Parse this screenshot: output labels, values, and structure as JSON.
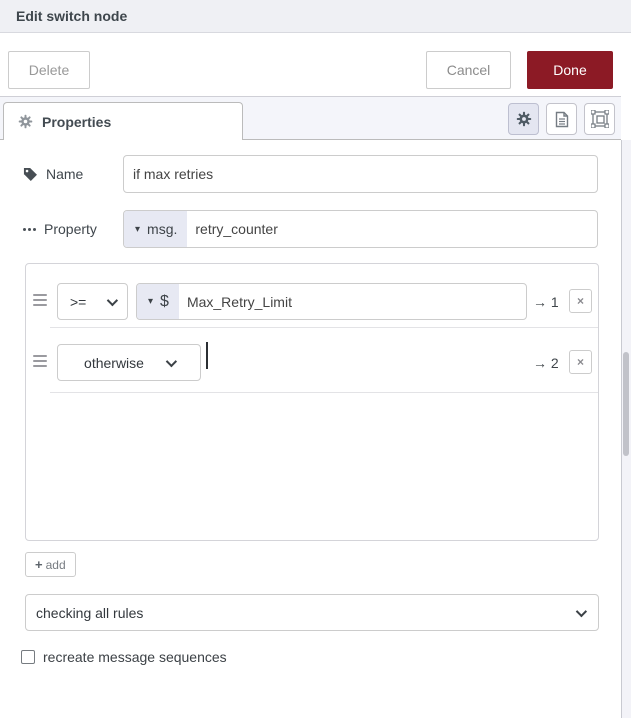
{
  "header": {
    "title": "Edit switch node"
  },
  "toolbar": {
    "delete_label": "Delete",
    "cancel_label": "Cancel",
    "done_label": "Done"
  },
  "tabbar": {
    "properties_label": "Properties",
    "icon_buttons": [
      "gear-icon",
      "description-icon",
      "group-icon"
    ]
  },
  "fields": {
    "name_label": "Name",
    "name_value": "if max retries",
    "property_label": "Property",
    "property_prefix_caret": "▾",
    "property_prefix": "msg.",
    "property_value": "retry_counter"
  },
  "rules": [
    {
      "operator": ">=",
      "value_prefix_caret": "▾",
      "value_type": "$",
      "value": "Max_Retry_Limit",
      "arrow": "→",
      "output": "1",
      "remove": "×"
    },
    {
      "operator": "otherwise",
      "arrow": "→",
      "output": "2",
      "remove": "×"
    }
  ],
  "add_button": {
    "plus": "+",
    "label": "add"
  },
  "mode_select": {
    "value": "checking all rules"
  },
  "options": {
    "recreate_label": "recreate message sequences",
    "checked": false
  },
  "colors": {
    "done_button_bg": "#8c1a25",
    "header_bg": "#eff0f4",
    "typed_input_prefix_bg": "#e7e9f3",
    "selected_icon_button_bg": "#e4e6f1",
    "tabbar_bg": "#f4f5fa"
  }
}
